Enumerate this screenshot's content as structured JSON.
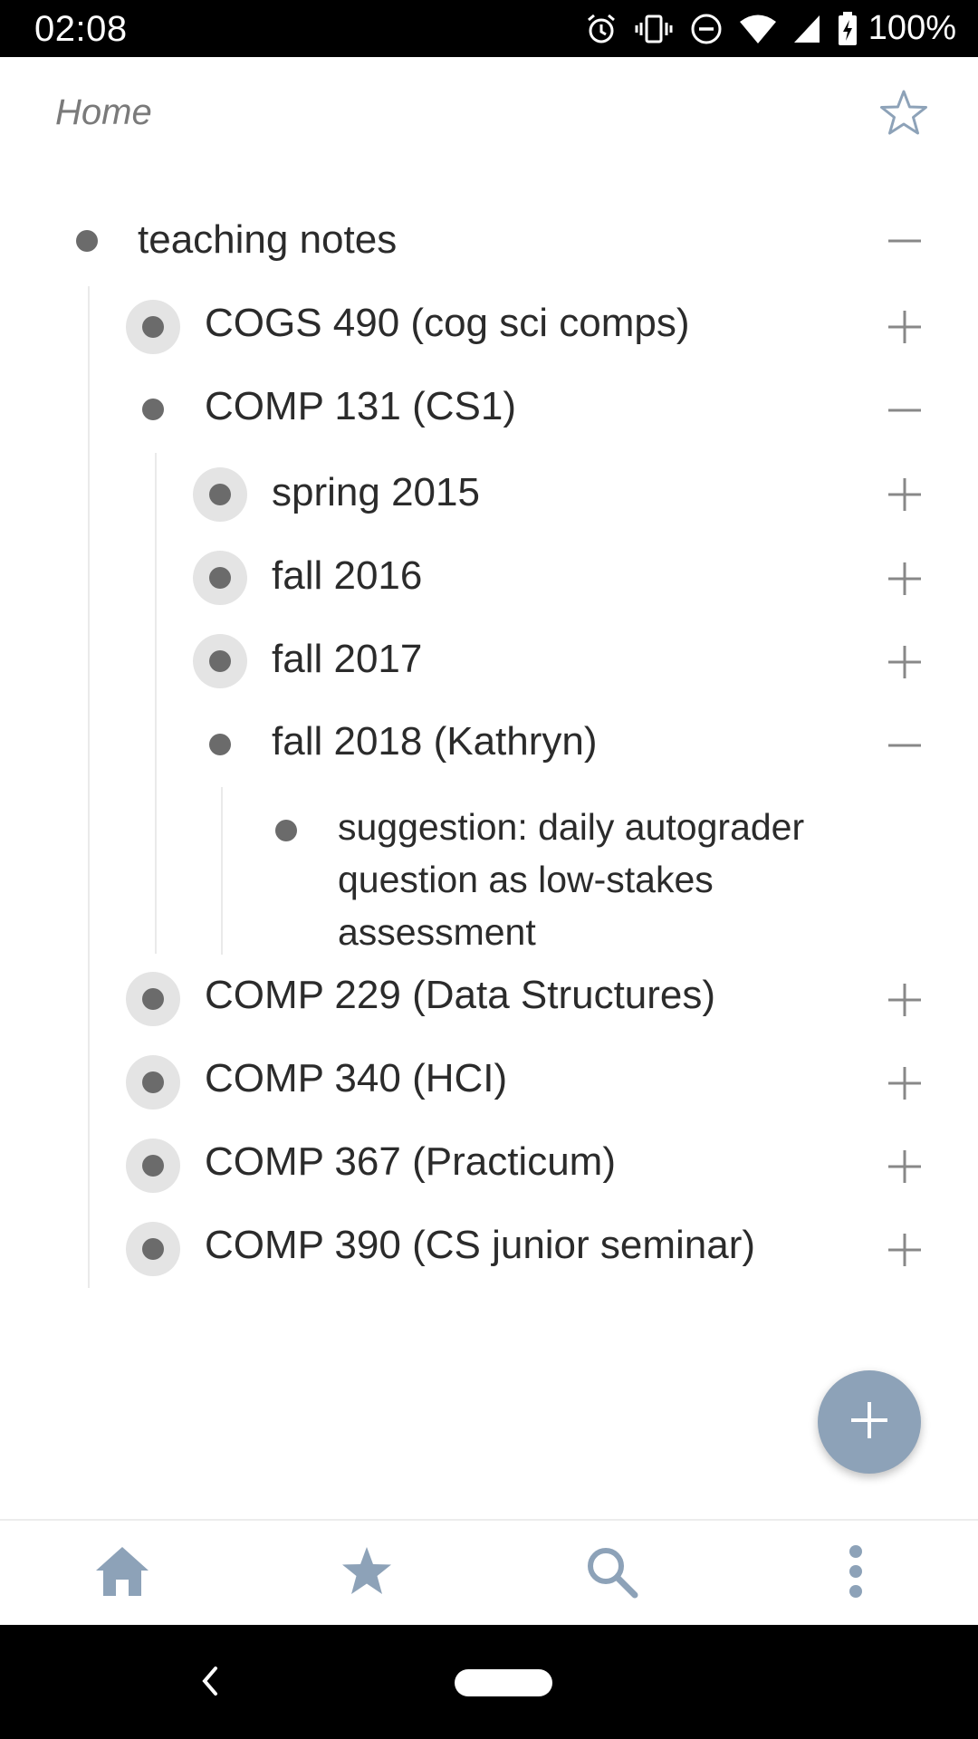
{
  "status_bar": {
    "time": "02:08",
    "battery": "100%",
    "icons": [
      "alarm-icon",
      "vibrate-icon",
      "do-not-disturb-icon",
      "wifi-icon",
      "signal-icon",
      "battery-charging-icon"
    ]
  },
  "header": {
    "title": "Home",
    "star_icon": "star-outline-icon"
  },
  "outline": {
    "root": {
      "label": "teaching notes",
      "state": "expanded"
    },
    "items": [
      {
        "label": "COGS 490 (cog sci comps)",
        "state": "collapsed"
      },
      {
        "label": "COMP 131 (CS1)",
        "state": "expanded"
      },
      {
        "label": "spring 2015",
        "state": "collapsed"
      },
      {
        "label": "fall 2016",
        "state": "collapsed"
      },
      {
        "label": "fall 2017",
        "state": "collapsed"
      },
      {
        "label": "fall 2018 (Kathryn)",
        "state": "expanded"
      },
      {
        "label": "suggestion: daily autograder question as low-stakes assessment",
        "state": "leaf"
      },
      {
        "label": "COMP 229 (Data Structures)",
        "state": "collapsed"
      },
      {
        "label": "COMP 340 (HCI)",
        "state": "collapsed"
      },
      {
        "label": "COMP 367 (Practicum)",
        "state": "collapsed"
      },
      {
        "label": "COMP 390 (CS junior seminar)",
        "state": "collapsed"
      }
    ]
  },
  "fab": {
    "icon": "plus-icon"
  },
  "bottom_nav": {
    "items": [
      "home-icon",
      "star-icon",
      "search-icon",
      "more-vert-icon"
    ]
  },
  "colors": {
    "accent": "#8da2b8",
    "bullet": "#6b6b6b",
    "bullet_halo": "#e4e4e4",
    "text": "#2b2b2b",
    "muted": "#7a7a7a"
  }
}
